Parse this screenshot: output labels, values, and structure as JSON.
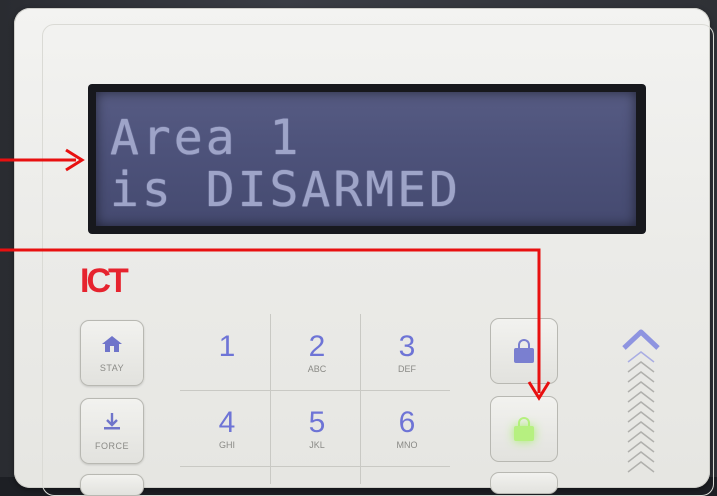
{
  "brand": "ICT",
  "display": {
    "line1": "Area 1",
    "line2": "is DISARMED"
  },
  "function_buttons": [
    {
      "label": "STAY",
      "icon": "home-icon"
    },
    {
      "label": "FORCE",
      "icon": "force-arm-icon"
    }
  ],
  "keypad": [
    {
      "digit": "1",
      "letters": ""
    },
    {
      "digit": "2",
      "letters": "ABC"
    },
    {
      "digit": "3",
      "letters": "DEF"
    },
    {
      "digit": "4",
      "letters": "GHI"
    },
    {
      "digit": "5",
      "letters": "JKL"
    },
    {
      "digit": "6",
      "letters": "MNO"
    }
  ],
  "lock_buttons": [
    {
      "state": "armed",
      "icon": "lock-icon",
      "lit": false
    },
    {
      "state": "disarmed",
      "icon": "lock-icon",
      "lit": true,
      "light_color": "#b6f080"
    }
  ],
  "annotation_color": "#e81010",
  "accent_color": "#6e74d6",
  "lcd_color": "#4d527a",
  "brand_color": "#e6232e"
}
